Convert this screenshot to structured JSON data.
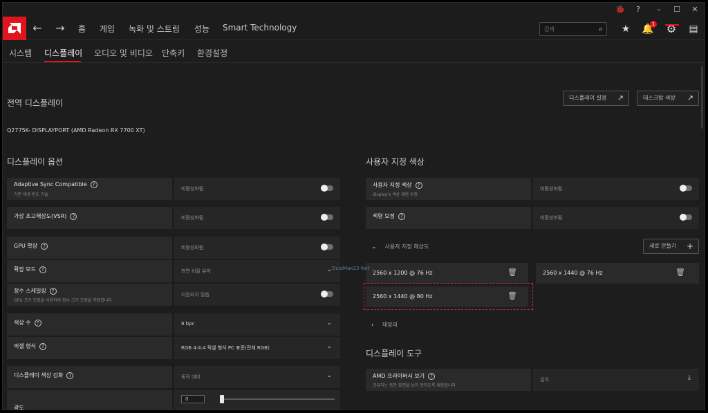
{
  "window": {
    "controls": {
      "bug": "🐞",
      "help": "?",
      "minimize": "–",
      "maximize": "☐",
      "close": "✕"
    }
  },
  "topnav": {
    "back": "←",
    "forward": "→",
    "items": [
      "홈",
      "게임",
      "녹화 및 스트림",
      "성능",
      "Smart Technology"
    ],
    "search_placeholder": "검색",
    "notification_count": "1",
    "icons": [
      "star-icon",
      "bell-icon",
      "gear-icon",
      "layout-icon"
    ],
    "accent_color": "#e1141d"
  },
  "subnav": {
    "tabs": [
      "시스템",
      "디스플레이",
      "오디오 및 비디오",
      "단축키",
      "환경설정"
    ],
    "active": "디스플레이"
  },
  "global": {
    "title": "전역 디스플레이",
    "display_name": "Q2775K- DISPLAYPORT (AMD Radeon RX 7700 XT)",
    "btn_display_settings": "디스플레이 설정",
    "btn_desktop_color": "데스크탑 색상"
  },
  "display_options": {
    "title": "디스플레이 옵션",
    "rows": [
      {
        "label": "Adaptive Sync Compatible",
        "sub": "가변 재생 빈도 기술",
        "value": "비활성화됨",
        "control": "toggle"
      },
      {
        "label": "가상 초고해상도(VSR)",
        "sub": "",
        "value": "비활성화됨",
        "control": "toggle"
      },
      {
        "label": "GPU 확장",
        "sub": "",
        "value": "비활성화됨",
        "control": "toggle"
      },
      {
        "label": "확장 모드",
        "sub": "",
        "value": "화면 비율 유지",
        "control": "dropdown"
      },
      {
        "label": "정수 스케일링",
        "sub": "GPU 크기 조정을 사용하여 정수 크기 조정을 허용합니다.",
        "value": "지원되지 않음",
        "control": "toggle"
      },
      {
        "label": "색상 수",
        "sub": "",
        "value": "8 bpc",
        "control": "dropdown"
      },
      {
        "label": "픽셀 형식",
        "sub": "",
        "value": "RGB 4:4:4 픽셀 형식 PC 표준(전체 RGB)",
        "control": "dropdown"
      },
      {
        "label": "디스플레이 색상 강화",
        "sub": "",
        "value": "동적 대비",
        "control": "dropdown"
      }
    ],
    "brightness_label": "광도",
    "brightness_value": "0",
    "brightness_level": 0
  },
  "custom_color": {
    "title": "사용자 지정 색상",
    "rows": [
      {
        "label": "사용자 지정 색상",
        "sub": "display's 색상 재현 수정",
        "value": "비활성화됨",
        "control": "toggle"
      },
      {
        "label": "색령 보정",
        "sub": "",
        "value": "비활성화됨",
        "control": "toggle"
      }
    ],
    "custom_resolution_label": "사용자 지정 해상도",
    "new_button": "새로 만들기",
    "resolutions": [
      "2560 x 1200 @ 76 Hz",
      "2560 x 1440 @ 76 Hz",
      "2560 x 1440 @ 80 Hz"
    ],
    "override_label": "재정의"
  },
  "display_tools": {
    "title": "디스플레이 도구",
    "privacy_label": "AMD 프라이버시 보기",
    "privacy_sub": "공유하는 동안 화면을 보지 못하도록 제한합니다",
    "privacy_value": "설치"
  },
  "watermark": "DualMax23-Net"
}
